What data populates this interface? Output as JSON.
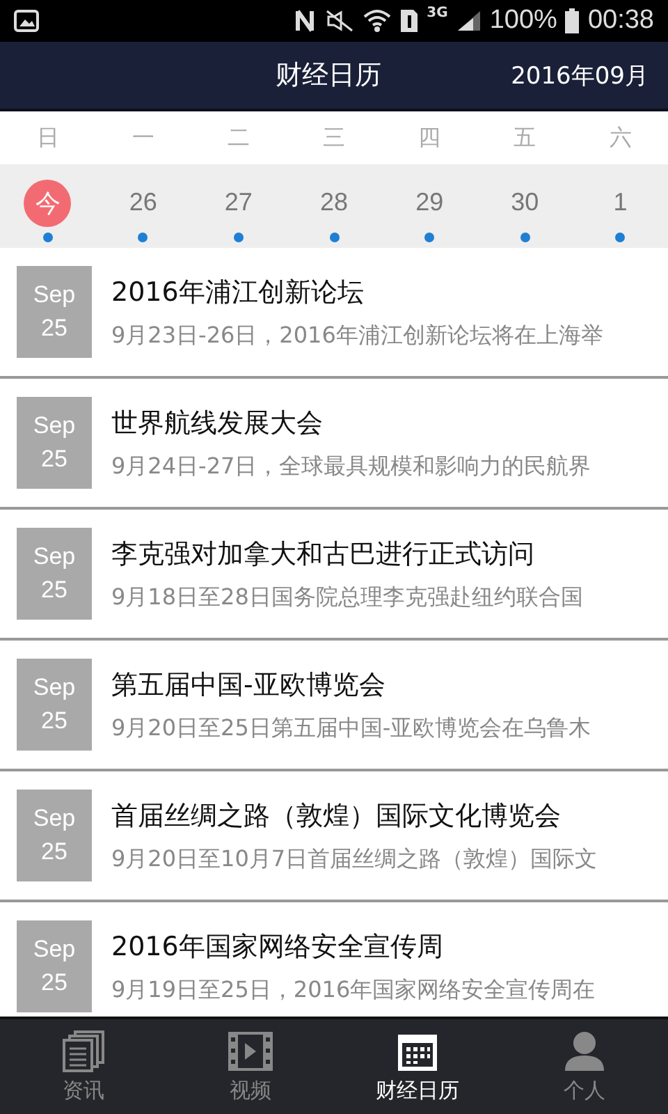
{
  "status_bar": {
    "network": "3G",
    "battery": "100%",
    "time": "00:38"
  },
  "header": {
    "title": "财经日历",
    "month": "2016年09月"
  },
  "weekdays": [
    "日",
    "一",
    "二",
    "三",
    "四",
    "五",
    "六"
  ],
  "dates": [
    {
      "label": "今",
      "selected": true,
      "has_events": true
    },
    {
      "label": "26",
      "selected": false,
      "has_events": true
    },
    {
      "label": "27",
      "selected": false,
      "has_events": true
    },
    {
      "label": "28",
      "selected": false,
      "has_events": true
    },
    {
      "label": "29",
      "selected": false,
      "has_events": true
    },
    {
      "label": "30",
      "selected": false,
      "has_events": true
    },
    {
      "label": "1",
      "selected": false,
      "has_events": true
    }
  ],
  "events": [
    {
      "month": "Sep",
      "day": "25",
      "title": "2016年浦江创新论坛",
      "summary": "9月23日-26日，2016年浦江创新论坛将在上海举"
    },
    {
      "month": "Sep",
      "day": "25",
      "title": "世界航线发展大会",
      "summary": "9月24日-27日，全球最具规模和影响力的民航界"
    },
    {
      "month": "Sep",
      "day": "25",
      "title": "李克强对加拿大和古巴进行正式访问",
      "summary": "9月18日至28日国务院总理李克强赴纽约联合国"
    },
    {
      "month": "Sep",
      "day": "25",
      "title": "第五届中国-亚欧博览会",
      "summary": "9月20日至25日第五届中国-亚欧博览会在乌鲁木"
    },
    {
      "month": "Sep",
      "day": "25",
      "title": "首届丝绸之路（敦煌）国际文化博览会",
      "summary": "9月20日至10月7日首届丝绸之路（敦煌）国际文"
    },
    {
      "month": "Sep",
      "day": "25",
      "title": "2016年国家网络安全宣传周",
      "summary": "9月19日至25日，2016年国家网络安全宣传周在"
    }
  ],
  "nav": [
    {
      "kind": "news",
      "label": "资讯",
      "selected": false
    },
    {
      "kind": "video",
      "label": "视频",
      "selected": false
    },
    {
      "kind": "calendar",
      "label": "财经日历",
      "selected": true
    },
    {
      "kind": "profile",
      "label": "个人",
      "selected": false
    }
  ]
}
